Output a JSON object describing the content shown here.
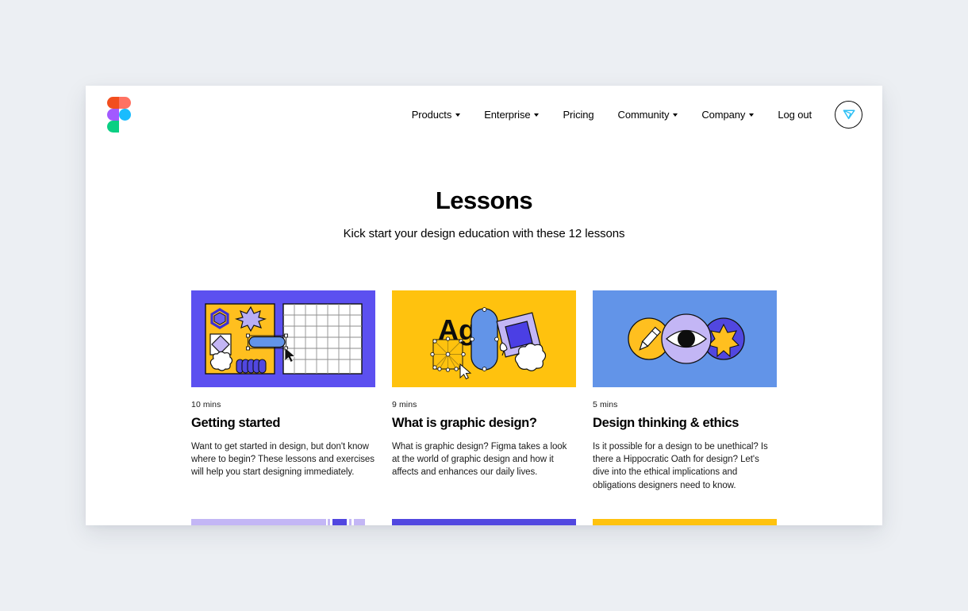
{
  "page": {
    "background_color": "#eceff3",
    "panel_color": "#ffffff"
  },
  "header": {
    "logo_name": "figma-logo",
    "logo_colors": {
      "top_left": "#f24e1e",
      "top_right": "#ff7262",
      "mid_left": "#a259ff",
      "mid_right": "#1abcfe",
      "bottom_left": "#0acf83"
    },
    "nav": [
      {
        "label": "Products",
        "has_dropdown": true
      },
      {
        "label": "Enterprise",
        "has_dropdown": true
      },
      {
        "label": "Pricing",
        "has_dropdown": false
      },
      {
        "label": "Community",
        "has_dropdown": true
      },
      {
        "label": "Company",
        "has_dropdown": true
      },
      {
        "label": "Log out",
        "has_dropdown": false
      }
    ],
    "avatar": {
      "name": "user-avatar",
      "icon": "paper-plane-icon",
      "icon_color": "#2ec0f5",
      "border_color": "#0b0b0b"
    }
  },
  "hero": {
    "title": "Lessons",
    "subtitle": "Kick start your design education with these 12 lessons"
  },
  "lessons": [
    {
      "duration": "10 mins",
      "title": "Getting started",
      "description": "Want to get started in design, but don't know where to begin? These lessons and exercises will help you start designing immediately.",
      "thumb_name": "getting-started-thumbnail",
      "thumb_bg": "#5c50f0",
      "thumb_panel": "#ffbf1f"
    },
    {
      "duration": "9 mins",
      "title": "What is graphic design?",
      "description": "What is graphic design? Figma takes a look at the world of graphic design and how it affects and enhances our daily lives.",
      "thumb_name": "graphic-design-thumbnail",
      "thumb_bg": "#ffc20e",
      "thumb_panel": "#6294e8"
    },
    {
      "duration": "5 mins",
      "title": "Design thinking & ethics",
      "description": "Is it possible for a design to be unethical? Is there a Hippocratic Oath for design? Let's dive into the ethical implications and obligations designers need to know.",
      "thumb_name": "design-thinking-ethics-thumbnail",
      "thumb_bg": "#6294e8",
      "thumb_panel": "#ffbf1f"
    }
  ],
  "next_row_peek": [
    {
      "name": "lesson-thumbnail-4-peek",
      "color": "#c3b6f5"
    },
    {
      "name": "lesson-thumbnail-5-peek",
      "color": "#5147e0"
    },
    {
      "name": "lesson-thumbnail-6-peek",
      "color": "#ffc20e"
    }
  ]
}
